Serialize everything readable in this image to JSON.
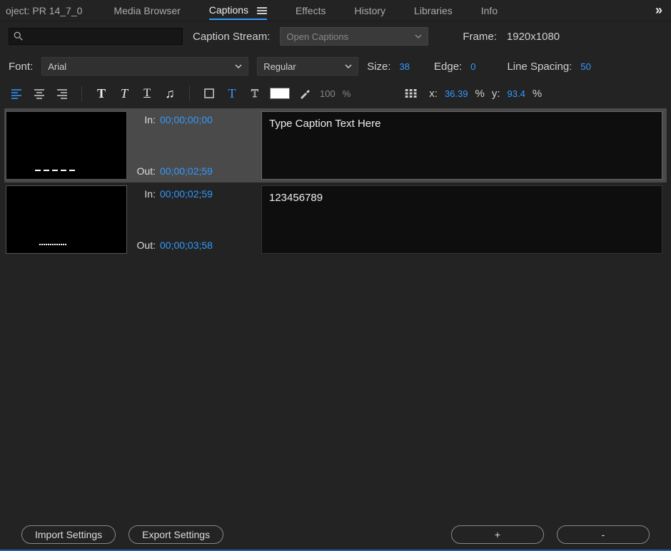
{
  "tabs": {
    "project": "oject: PR 14_7_0",
    "media_browser": "Media Browser",
    "captions": "Captions",
    "effects": "Effects",
    "history": "History",
    "libraries": "Libraries",
    "info": "Info"
  },
  "stream_row": {
    "caption_stream_label": "Caption Stream:",
    "caption_stream_value": "Open Captions",
    "frame_label": "Frame:",
    "frame_value": "1920x1080"
  },
  "font_row": {
    "font_label": "Font:",
    "font_value": "Arial",
    "style_value": "Regular",
    "size_label": "Size:",
    "size_value": "38",
    "edge_label": "Edge:",
    "edge_value": "0",
    "line_spacing_label": "Line Spacing:",
    "line_spacing_value": "50"
  },
  "toolbar": {
    "opacity_value": "100",
    "opacity_unit": "%",
    "x_label": "x:",
    "x_value": "36.39",
    "x_unit": "%",
    "y_label": "y:",
    "y_value": "93.4",
    "y_unit": "%"
  },
  "captions": [
    {
      "in_label": "In:",
      "in_value": "00;00;00;00",
      "out_label": "Out:",
      "out_value": "00;00;02;59",
      "text": "Type Caption Text Here",
      "selected": true
    },
    {
      "in_label": "In:",
      "in_value": "00;00;02;59",
      "out_label": "Out:",
      "out_value": "00;00;03;58",
      "text": "123456789",
      "selected": false
    }
  ],
  "footer": {
    "import": "Import Settings",
    "export": "Export Settings",
    "add": "+",
    "remove": "-"
  }
}
